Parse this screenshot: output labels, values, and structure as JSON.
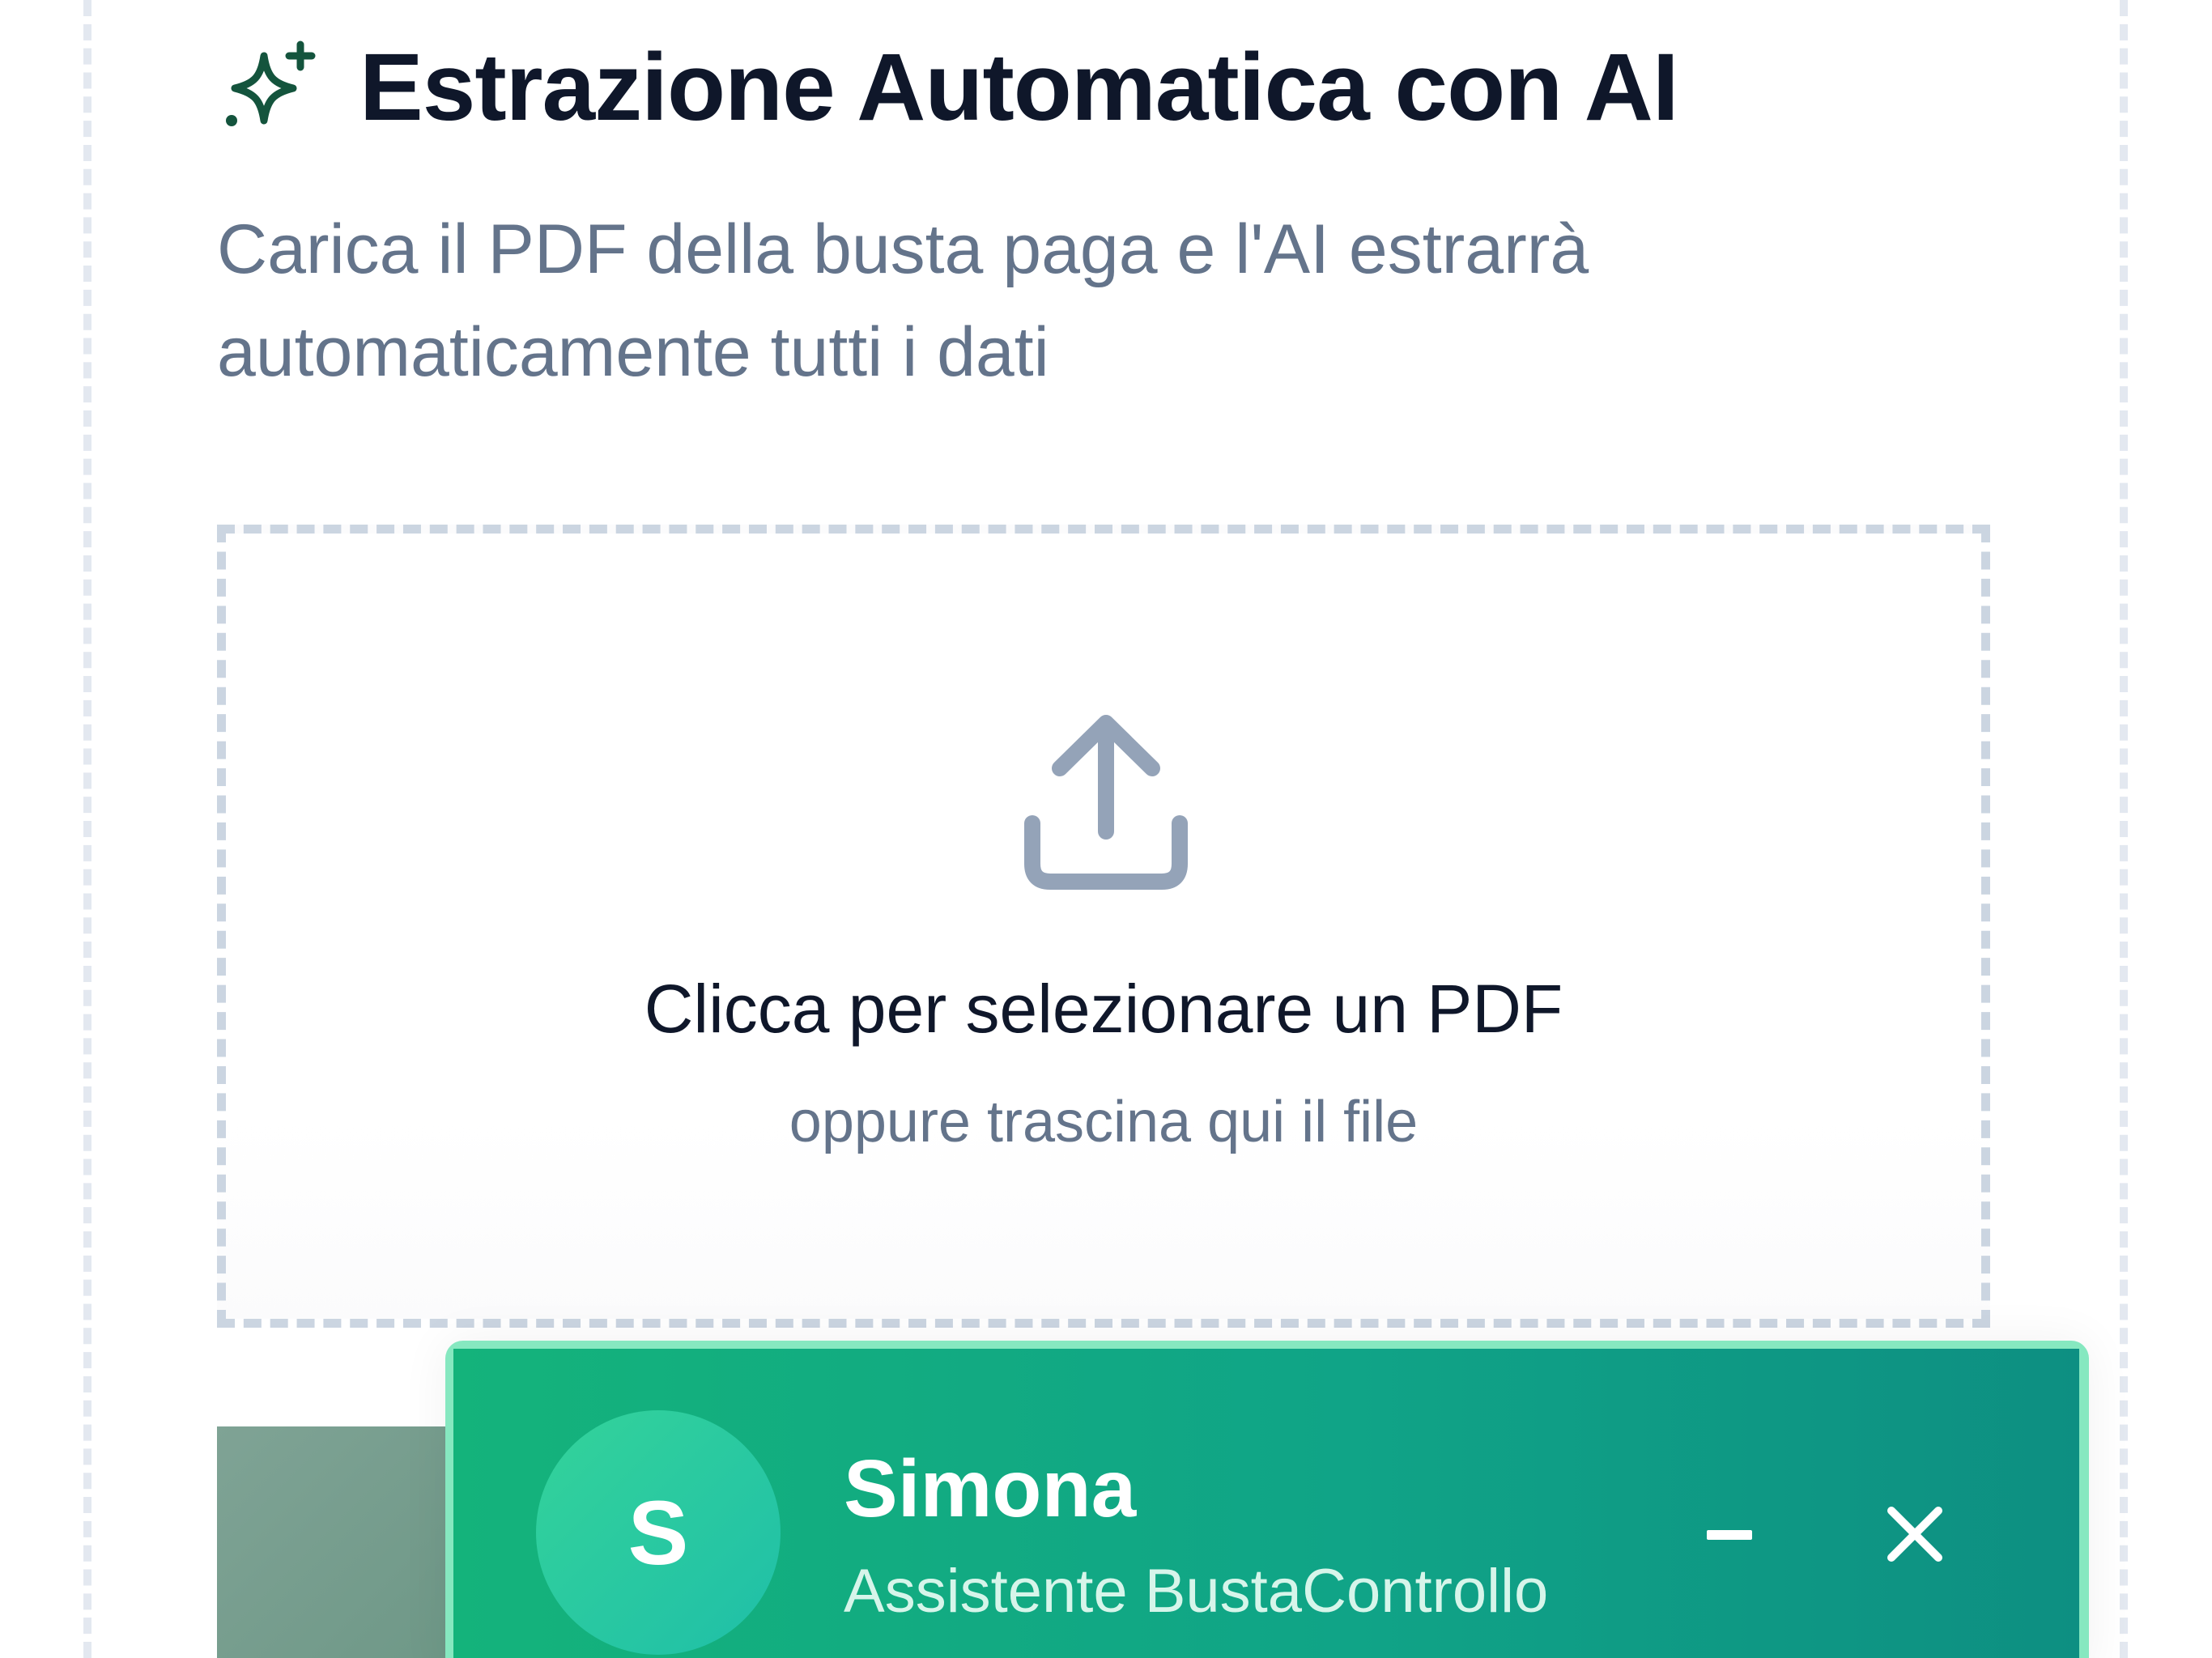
{
  "header": {
    "icon": "sparkles-icon",
    "title": "Estrazione Automatica con AI",
    "subtitle": "Carica il PDF della busta paga e l'AI estrarrà automaticamente tutti i dati"
  },
  "upload": {
    "icon": "upload-icon",
    "title": "Clicca per selezionare un PDF",
    "hint": "oppure trascina qui il file"
  },
  "chat": {
    "avatar_initial": "S",
    "name": "Simona",
    "role": "Assistente BustaControllo",
    "minimize_icon": "minus-icon",
    "close_icon": "close-icon"
  },
  "colors": {
    "title": "#0f172a",
    "muted": "#64748b",
    "accent_green": "#10a487",
    "icon_dark_green": "#14543d",
    "dashed_border": "#cbd5e1"
  }
}
